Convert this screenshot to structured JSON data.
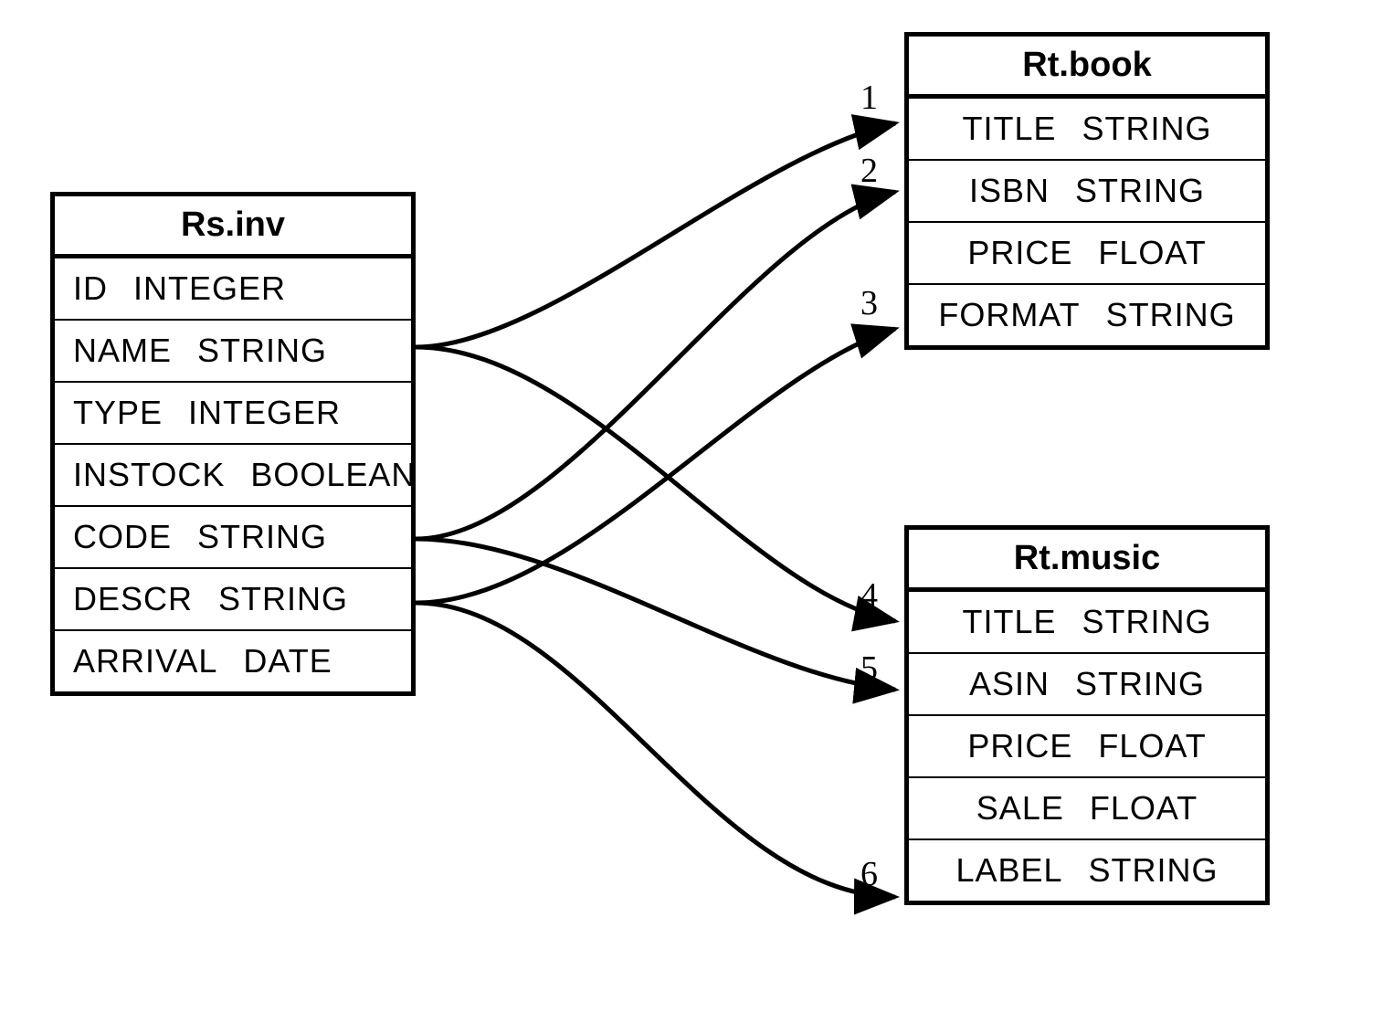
{
  "tables": {
    "source": {
      "title": "Rs.inv",
      "fields": [
        {
          "name": "ID",
          "type": "INTEGER"
        },
        {
          "name": "NAME",
          "type": "STRING"
        },
        {
          "name": "TYPE",
          "type": "INTEGER"
        },
        {
          "name": "INSTOCK",
          "type": "BOOLEAN"
        },
        {
          "name": "CODE",
          "type": "STRING"
        },
        {
          "name": "DESCR",
          "type": "STRING"
        },
        {
          "name": "ARRIVAL",
          "type": "DATE"
        }
      ]
    },
    "book": {
      "title": "Rt.book",
      "fields": [
        {
          "name": "TITLE",
          "type": "STRING"
        },
        {
          "name": "ISBN",
          "type": "STRING"
        },
        {
          "name": "PRICE",
          "type": "FLOAT"
        },
        {
          "name": "FORMAT",
          "type": "STRING"
        }
      ]
    },
    "music": {
      "title": "Rt.music",
      "fields": [
        {
          "name": "TITLE",
          "type": "STRING"
        },
        {
          "name": "ASIN",
          "type": "STRING"
        },
        {
          "name": "PRICE",
          "type": "FLOAT"
        },
        {
          "name": "SALE",
          "type": "FLOAT"
        },
        {
          "name": "LABEL",
          "type": "STRING"
        }
      ]
    }
  },
  "mappings": [
    {
      "num": "1",
      "from_field": "NAME",
      "to_table": "book",
      "to_field": "TITLE"
    },
    {
      "num": "2",
      "from_field": "CODE",
      "to_table": "book",
      "to_field": "ISBN"
    },
    {
      "num": "3",
      "from_field": "DESCR",
      "to_table": "book",
      "to_field": "FORMAT"
    },
    {
      "num": "4",
      "from_field": "NAME",
      "to_table": "music",
      "to_field": "TITLE"
    },
    {
      "num": "5",
      "from_field": "CODE",
      "to_table": "music",
      "to_field": "ASIN"
    },
    {
      "num": "6",
      "from_field": "DESCR",
      "to_table": "music",
      "to_field": "LABEL"
    }
  ]
}
